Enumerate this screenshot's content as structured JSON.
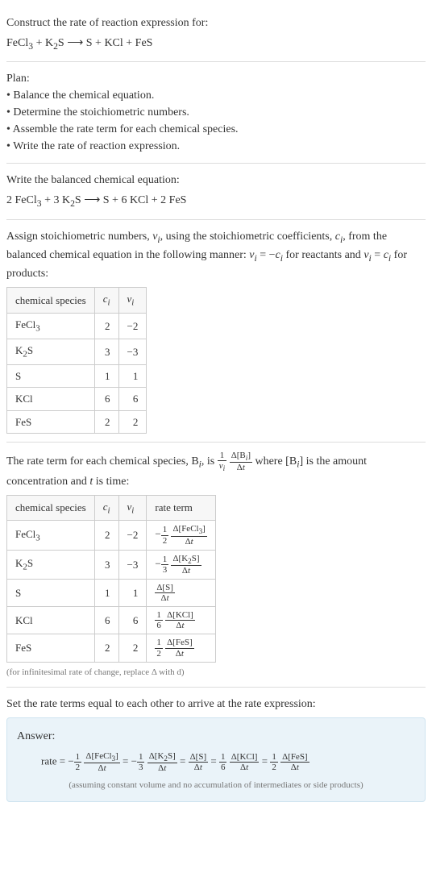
{
  "intro": {
    "prompt": "Construct the rate of reaction expression for:",
    "equation_html": "FeCl<sub>3</sub> + K<sub>2</sub>S ⟶ S + KCl + FeS"
  },
  "plan": {
    "title": "Plan:",
    "items": [
      "Balance the chemical equation.",
      "Determine the stoichiometric numbers.",
      "Assemble the rate term for each chemical species.",
      "Write the rate of reaction expression."
    ]
  },
  "balanced": {
    "intro": "Write the balanced chemical equation:",
    "equation_html": "2 FeCl<sub>3</sub> + 3 K<sub>2</sub>S ⟶ S + 6 KCl + 2 FeS"
  },
  "stoich": {
    "intro_html": "Assign stoichiometric numbers, <i>ν<sub>i</sub></i>, using the stoichiometric coefficients, <i>c<sub>i</sub></i>, from the balanced chemical equation in the following manner: <i>ν<sub>i</sub></i> = −<i>c<sub>i</sub></i> for reactants and <i>ν<sub>i</sub></i> = <i>c<sub>i</sub></i> for products:",
    "headers": [
      "chemical species",
      "cᵢ",
      "νᵢ"
    ],
    "rows": [
      {
        "species_html": "FeCl<sub>3</sub>",
        "c": "2",
        "nu": "−2"
      },
      {
        "species_html": "K<sub>2</sub>S",
        "c": "3",
        "nu": "−3"
      },
      {
        "species_html": "S",
        "c": "1",
        "nu": "1"
      },
      {
        "species_html": "KCl",
        "c": "6",
        "nu": "6"
      },
      {
        "species_html": "FeS",
        "c": "2",
        "nu": "2"
      }
    ]
  },
  "rateterm": {
    "intro_html": "The rate term for each chemical species, B<sub><i>i</i></sub>, is <span class=\"frac\"><span class=\"frac-num\">1</span><span class=\"frac-den\"><i>ν<sub>i</sub></i></span></span> <span class=\"frac\"><span class=\"frac-num\">Δ[B<sub><i>i</i></sub>]</span><span class=\"frac-den\">Δ<i>t</i></span></span> where [B<sub><i>i</i></sub>] is the amount concentration and <i>t</i> is time:",
    "headers": [
      "chemical species",
      "cᵢ",
      "νᵢ",
      "rate term"
    ],
    "rows": [
      {
        "species_html": "FeCl<sub>3</sub>",
        "c": "2",
        "nu": "−2",
        "rate_html": "−<span class=\"frac\"><span class=\"frac-num\">1</span><span class=\"frac-den\">2</span></span> <span class=\"frac\"><span class=\"frac-num\">Δ[FeCl<sub>3</sub>]</span><span class=\"frac-den\">Δ<i>t</i></span></span>"
      },
      {
        "species_html": "K<sub>2</sub>S",
        "c": "3",
        "nu": "−3",
        "rate_html": "−<span class=\"frac\"><span class=\"frac-num\">1</span><span class=\"frac-den\">3</span></span> <span class=\"frac\"><span class=\"frac-num\">Δ[K<sub>2</sub>S]</span><span class=\"frac-den\">Δ<i>t</i></span></span>"
      },
      {
        "species_html": "S",
        "c": "1",
        "nu": "1",
        "rate_html": "<span class=\"frac\"><span class=\"frac-num\">Δ[S]</span><span class=\"frac-den\">Δ<i>t</i></span></span>"
      },
      {
        "species_html": "KCl",
        "c": "6",
        "nu": "6",
        "rate_html": "<span class=\"frac\"><span class=\"frac-num\">1</span><span class=\"frac-den\">6</span></span> <span class=\"frac\"><span class=\"frac-num\">Δ[KCl]</span><span class=\"frac-den\">Δ<i>t</i></span></span>"
      },
      {
        "species_html": "FeS",
        "c": "2",
        "nu": "2",
        "rate_html": "<span class=\"frac\"><span class=\"frac-num\">1</span><span class=\"frac-den\">2</span></span> <span class=\"frac\"><span class=\"frac-num\">Δ[FeS]</span><span class=\"frac-den\">Δ<i>t</i></span></span>"
      }
    ],
    "footnote": "(for infinitesimal rate of change, replace Δ with d)"
  },
  "final": {
    "intro": "Set the rate terms equal to each other to arrive at the rate expression:",
    "answer_label": "Answer:",
    "rate_html": "rate = −<span class=\"frac\"><span class=\"frac-num\">1</span><span class=\"frac-den\">2</span></span> <span class=\"frac\"><span class=\"frac-num\">Δ[FeCl<sub>3</sub>]</span><span class=\"frac-den\">Δ<i>t</i></span></span> = −<span class=\"frac\"><span class=\"frac-num\">1</span><span class=\"frac-den\">3</span></span> <span class=\"frac\"><span class=\"frac-num\">Δ[K<sub>2</sub>S]</span><span class=\"frac-den\">Δ<i>t</i></span></span> = <span class=\"frac\"><span class=\"frac-num\">Δ[S]</span><span class=\"frac-den\">Δ<i>t</i></span></span> = <span class=\"frac\"><span class=\"frac-num\">1</span><span class=\"frac-den\">6</span></span> <span class=\"frac\"><span class=\"frac-num\">Δ[KCl]</span><span class=\"frac-den\">Δ<i>t</i></span></span> = <span class=\"frac\"><span class=\"frac-num\">1</span><span class=\"frac-den\">2</span></span> <span class=\"frac\"><span class=\"frac-num\">Δ[FeS]</span><span class=\"frac-den\">Δ<i>t</i></span></span>",
    "note": "(assuming constant volume and no accumulation of intermediates or side products)"
  }
}
